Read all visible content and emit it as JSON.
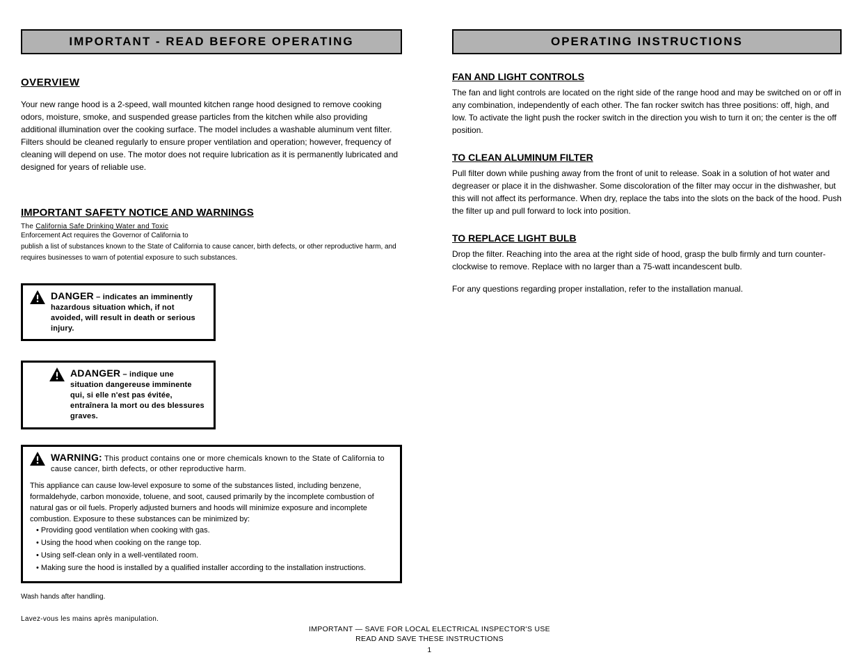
{
  "left": {
    "header": "IMPORTANT - READ BEFORE OPERATING",
    "overview_title": "OVERVIEW",
    "overview_body": "Your new range hood is a 2-speed, wall mounted kitchen range hood designed to remove cooking odors, moisture, smoke, and suspended grease particles from the kitchen while also providing additional illumination over the cooking surface. The model includes a washable aluminum vent filter. Filters should be cleaned regularly to ensure proper ventilation and operation; however, frequency of cleaning will depend on use. The motor does not require lubrication as it is permanently lubricated and designed for years of reliable use.",
    "notice_title": "IMPORTANT SAFETY NOTICE AND WARNINGS",
    "notice_sub_plain": "The ",
    "notice_sub_underlined": "California Safe Drinking Water and Toxic",
    "notice_line1_underlined": "Enforcement Act",
    "notice_line1_plain": " requires the Governor of California to",
    "notice_line2": "publish a list of substances known to the State of California to cause cancer, birth defects, or other reproductive harm, and requires businesses to warn of potential exposure to such substances.",
    "danger": {
      "lead": "DANGER",
      "rest": " – indicates an imminently hazardous situation which, if not avoided, will result in death or serious injury."
    },
    "adanger": {
      "lead": "ADANGER",
      "rest": " – indique une situation dangereuse imminente qui, si elle n'est pas évitée, entraînera la mort ou des blessures graves."
    },
    "warning": {
      "lead": "WARNING:",
      "rest": " This product contains one or more chemicals known to the State of California to cause cancer, birth defects, or other reproductive harm.",
      "body_pre": "This appliance can cause low-level exposure to some of the substances listed, including benzene, formaldehyde, carbon monoxide, toluene, and soot, caused primarily by the incomplete combustion of natural gas or oil fuels. Properly adjusted burners and hoods will minimize exposure and incomplete combustion. Exposure to these substances can be minimized by:",
      "items": [
        "• Providing good ventilation when cooking with gas.",
        "• Using the hood when cooking on the range top.",
        "• Using self-clean only in a well-ventilated room.",
        "• Making sure the hood is installed by a qualified installer according to the installation instructions."
      ]
    },
    "additions": "Wash hands after handling.",
    "additions_sub": "Lavez-vous les mains après manipulation."
  },
  "right": {
    "header": "OPERATING INSTRUCTIONS",
    "blocks": [
      {
        "title": "FAN AND LIGHT CONTROLS",
        "body": "The fan and light controls are located on the right side of the range hood and may be switched on or off in any combination, independently of each other. The fan rocker switch has three positions: off, high, and low. To activate the light push the rocker switch in the direction you wish to turn it on; the center is the off position."
      },
      {
        "title": "TO CLEAN ALUMINUM FILTER",
        "body": "Pull filter down while pushing away from the front of unit to release. Soak in a solution of hot water and degreaser or place it in the dishwasher. Some discoloration of the filter may occur in the dishwasher, but this will not affect its performance. When dry, replace the tabs into the slots on the back of the hood. Push the filter up and pull forward to lock into position."
      },
      {
        "title": "TO REPLACE LIGHT BULB",
        "body": "Drop the filter. Reaching into the area at the right side of hood, grasp the bulb firmly and turn counter-clockwise to remove. Replace with no larger than a 75-watt incandescent bulb."
      }
    ],
    "refer": "For any questions regarding proper installation, refer to the installation manual."
  },
  "footer": {
    "line1": "IMPORTANT  —  SAVE FOR LOCAL ELECTRICAL INSPECTOR'S USE",
    "line2": "READ AND SAVE THESE INSTRUCTIONS",
    "page": "1"
  }
}
